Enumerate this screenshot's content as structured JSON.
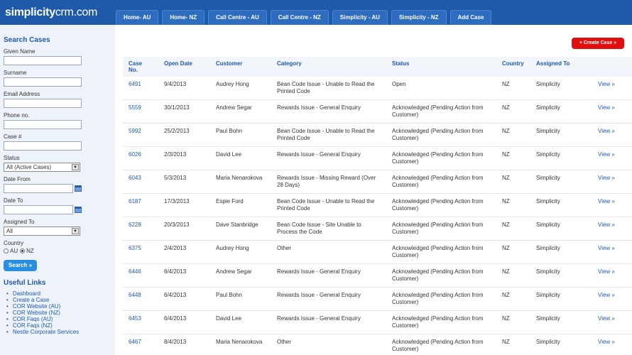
{
  "app": {
    "logo_bold": "simplicity",
    "logo_rest": "crm.com"
  },
  "tabs": [
    "Home- AU",
    "Home- NZ",
    "Call Centre - AU",
    "Call Centre - NZ",
    "Simplicity - AU",
    "Simplicity - NZ",
    "Add Case"
  ],
  "sidebar": {
    "title": "Search Cases",
    "fields": {
      "given_name": "Given Name",
      "surname": "Surname",
      "email": "Email Address",
      "phone": "Phone no.",
      "case_no": "Case #",
      "status": "Status",
      "status_value": "All (Active Cases)",
      "date_from": "Date From",
      "date_to": "Date To",
      "assigned_to": "Assigned To",
      "assigned_value": "All",
      "country": "Country",
      "country_au": "AU",
      "country_nz": "NZ"
    },
    "search_button": "Search »",
    "links_title": "Useful Links",
    "links": [
      "Dashboard",
      "Create a Case",
      "COR Website (AU)",
      "COR Website (NZ)",
      "COR Faqs (AU)",
      "COR Faqs (NZ)",
      "Nestle Corporate Services"
    ]
  },
  "main": {
    "create_button": "+ Create Case »",
    "columns": [
      "Case No.",
      "Open Date",
      "Customer",
      "Category",
      "Status",
      "Country",
      "Assigned To"
    ],
    "rows": [
      {
        "case": "6491",
        "date": "9/4/2013",
        "customer": "Audrey Hong",
        "category": "Bean Code Issue - Unable to Read the Printed Code",
        "status": "Open",
        "country": "NZ",
        "assigned": "Simplicity",
        "view": "View »"
      },
      {
        "case": "5559",
        "date": "30/1/2013",
        "customer": "Andrew Segar",
        "category": "Rewards Issue - General Enquiry",
        "status": "Acknowledged (Pending Action from Customer)",
        "country": "NZ",
        "assigned": "Simplicity",
        "view": "View »"
      },
      {
        "case": "5992",
        "date": "25/2/2013",
        "customer": "Paul Bohn",
        "category": "Bean Code Issue - Unable to Read the Printed Code",
        "status": "Acknowledged (Pending Action from Customer)",
        "country": "NZ",
        "assigned": "Simplicity",
        "view": "View »"
      },
      {
        "case": "6026",
        "date": "2/3/2013",
        "customer": "David Lee",
        "category": "Rewards Issue - General Enquiry",
        "status": "Acknowledged (Pending Action from Customer)",
        "country": "NZ",
        "assigned": "Simplicity",
        "view": "View »"
      },
      {
        "case": "6043",
        "date": "5/3/2013",
        "customer": "Maria Nenarokova",
        "category": "Rewards Issue - Missing Reward (Over 28 Days)",
        "status": "Acknowledged (Pending Action from Customer)",
        "country": "NZ",
        "assigned": "Simplicity",
        "view": "View »"
      },
      {
        "case": "6187",
        "date": "17/3/2013",
        "customer": "Espie Ford",
        "category": "Bean Code Issue - Unable to Read the Printed Code",
        "status": "Acknowledged (Pending Action from Customer)",
        "country": "NZ",
        "assigned": "Simplicity",
        "view": "View »"
      },
      {
        "case": "6228",
        "date": "20/3/2013",
        "customer": "Dave Stanbridge",
        "category": "Bean Code Issue - Site Unable to Process the Code",
        "status": "Acknowledged (Pending Action from Customer)",
        "country": "NZ",
        "assigned": "Simplicity",
        "view": "View »"
      },
      {
        "case": "6375",
        "date": "2/4/2013",
        "customer": "Audrey Hong",
        "category": "Other",
        "status": "Acknowledged (Pending Action from Customer)",
        "country": "NZ",
        "assigned": "Simplicity",
        "view": "View »"
      },
      {
        "case": "6446",
        "date": "6/4/2013",
        "customer": "Andrew Segar",
        "category": "Rewards Issue - General Enquiry",
        "status": "Acknowledged (Pending Action from Customer)",
        "country": "NZ",
        "assigned": "Simplicity",
        "view": "View »"
      },
      {
        "case": "6448",
        "date": "6/4/2013",
        "customer": "Paul Bohn",
        "category": "Rewards Issue - General Enquiry",
        "status": "Acknowledged (Pending Action from Customer)",
        "country": "NZ",
        "assigned": "Simplicity",
        "view": "View »"
      },
      {
        "case": "6453",
        "date": "6/4/2013",
        "customer": "David Lee",
        "category": "Rewards Issue - General Enquiry",
        "status": "Acknowledged (Pending Action from Customer)",
        "country": "NZ",
        "assigned": "Simplicity",
        "view": "View »"
      },
      {
        "case": "6467",
        "date": "8/4/2013",
        "customer": "Maria Nenarokova",
        "category": "Other",
        "status": "Acknowledged (Pending Action from Customer)",
        "country": "NZ",
        "assigned": "Simplicity",
        "view": "View »"
      }
    ]
  },
  "colors": {
    "brand_blue": "#1f5aa8",
    "create_red": "#e01010",
    "search_blue": "#2a8ee0"
  }
}
